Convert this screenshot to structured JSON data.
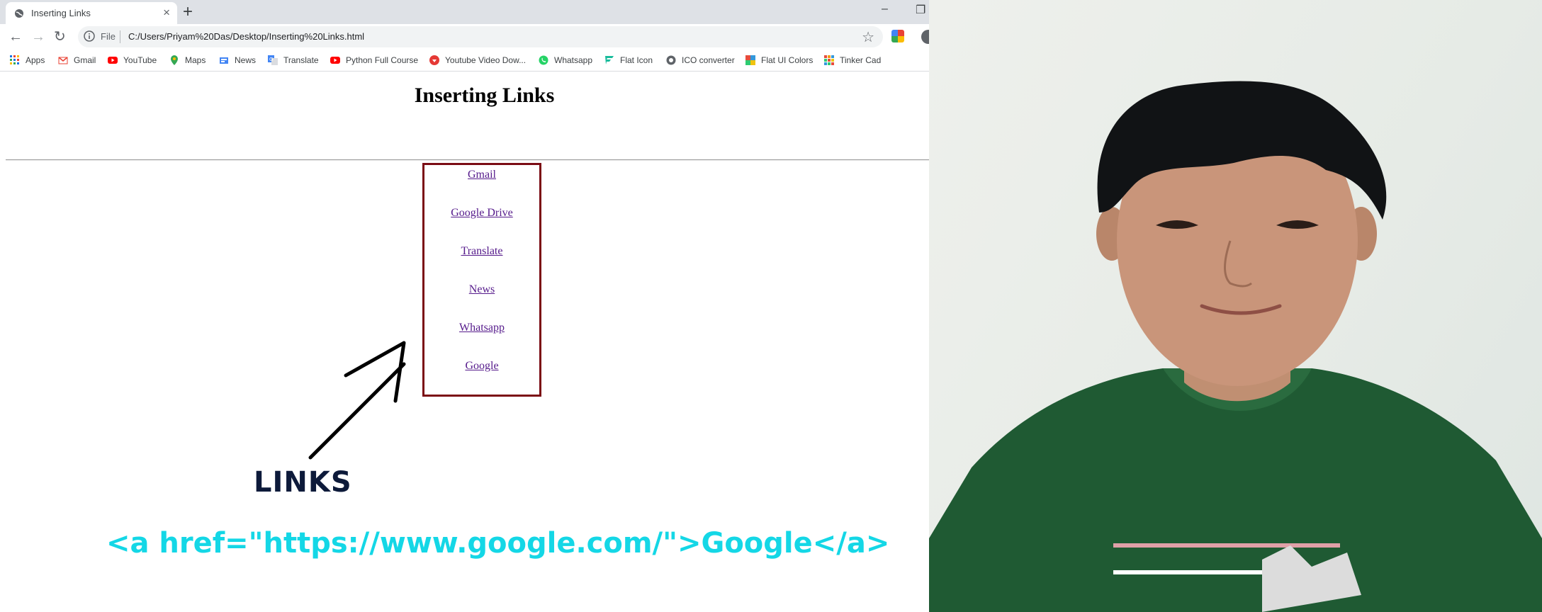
{
  "browser": {
    "tab_title": "Inserting Links",
    "file_label": "File",
    "url": "C:/Users/Priyam%20Das/Desktop/Inserting%20Links.html",
    "bookmarks": [
      "Apps",
      "Gmail",
      "YouTube",
      "Maps",
      "News",
      "Translate",
      "Python Full Course",
      "Youtube Video Dow...",
      "Whatsapp",
      "Flat Icon",
      "ICO converter",
      "Flat UI Colors",
      "Tinker Cad"
    ]
  },
  "page": {
    "heading": "Inserting Links",
    "links": [
      "Gmail",
      "Google Drive",
      "Translate",
      "News",
      "Whatsapp",
      "Google"
    ]
  },
  "annotation": {
    "label": "LINKS",
    "code": "<a href=\"https://www.google.com/\">Google</a>"
  },
  "colors": {
    "tab_bar": "#dee1e6",
    "box_border": "#7b0c14",
    "link": "#551a8b",
    "code_text": "#14d7e6",
    "label_text": "#0d1a3a",
    "shirt": "#1f5a33"
  }
}
